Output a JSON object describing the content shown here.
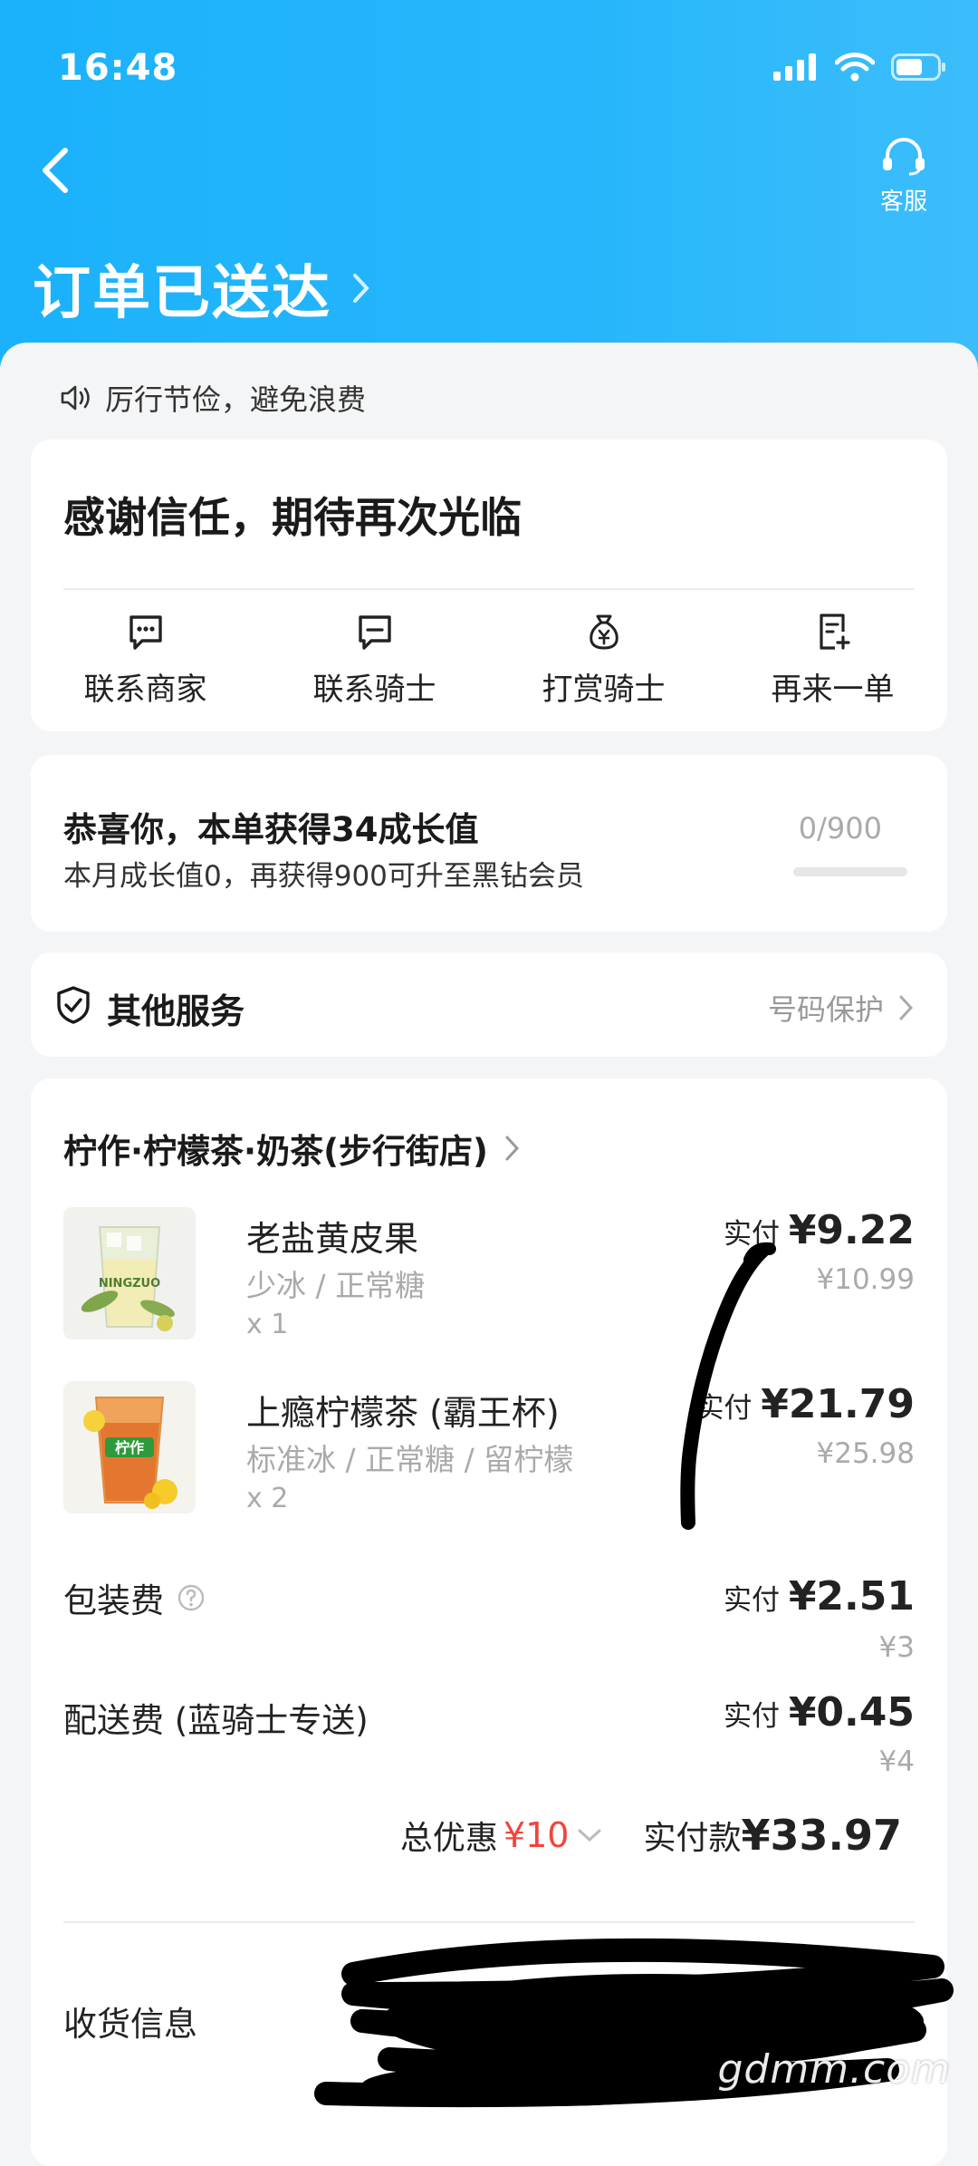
{
  "status_bar": {
    "time": "16:48"
  },
  "header": {
    "service_label": "客服",
    "title": "订单已送达"
  },
  "notice": "厉行节俭，避免浪费",
  "thanks_card": {
    "message": "感谢信任，期待再次光临",
    "actions": [
      {
        "label": "联系商家",
        "icon": "chat-icon"
      },
      {
        "label": "联系骑士",
        "icon": "chat-icon"
      },
      {
        "label": "打赏骑士",
        "icon": "money-bag-icon"
      },
      {
        "label": "再来一单",
        "icon": "reorder-icon"
      }
    ]
  },
  "growth_card": {
    "title": "恭喜你，本单获得34成长值",
    "subtitle": "本月成长值0，再获得900可升至黑钻会员",
    "progress_text": "0/900",
    "progress_fraction": 0
  },
  "other_services": {
    "label": "其他服务",
    "right_text": "号码保护"
  },
  "order": {
    "store_name": "柠作·柠檬茶·奶茶(步行街店)",
    "items": [
      {
        "name": "老盐黄皮果",
        "spec": "少冰 / 正常糖",
        "qty": "x 1",
        "paid_label": "实付",
        "paid_amount": "¥9.22",
        "original": "¥10.99",
        "thumb_text": "NINGZUO"
      },
      {
        "name": "上瘾柠檬茶 (霸王杯)",
        "spec": "标准冰 / 正常糖 / 留柠檬",
        "qty": "x 2",
        "paid_label": "实付",
        "paid_amount": "¥21.79",
        "original": "¥25.98",
        "thumb_text": "柠作"
      }
    ],
    "fees": [
      {
        "label": "包装费",
        "paid_label": "实付",
        "paid_amount": "¥2.51",
        "original": "¥3"
      },
      {
        "label": "配送费 (蓝骑士专送)",
        "paid_label": "实付",
        "paid_amount": "¥0.45",
        "original": "¥4"
      }
    ],
    "total_discount_label": "总优惠",
    "total_discount_amount": "¥10",
    "total_paid_label": "实付款",
    "total_paid_amount": "¥33.97",
    "receiver_label": "收货信息"
  },
  "watermark": "gdmm.com",
  "colors": {
    "header_blue": "#1bb2fb",
    "discount_red": "#f2443b"
  }
}
